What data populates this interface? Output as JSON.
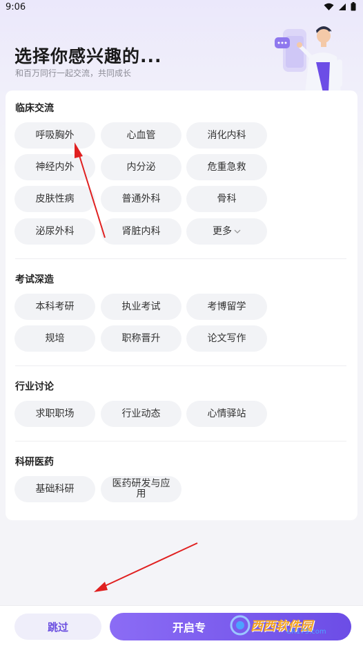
{
  "status_bar": {
    "time": "9:06"
  },
  "header": {
    "title": "选择你感兴趣的...",
    "subtitle": "和百万同行一起交流，共同成长"
  },
  "sections": [
    {
      "title": "临床交流",
      "tags": [
        "呼吸胸外",
        "心血管",
        "消化内科",
        "神经内外",
        "内分泌",
        "危重急救",
        "皮肤性病",
        "普通外科",
        "骨科",
        "泌尿外科",
        "肾脏内科"
      ],
      "more_label": "更多"
    },
    {
      "title": "考试深造",
      "tags": [
        "本科考研",
        "执业考试",
        "考博留学",
        "规培",
        "职称晋升",
        "论文写作"
      ]
    },
    {
      "title": "行业讨论",
      "tags": [
        "求职职场",
        "行业动态",
        "心情驿站"
      ]
    },
    {
      "title": "科研医药",
      "tags": [
        "基础科研",
        "医药研发与应用"
      ]
    }
  ],
  "footer": {
    "skip_label": "跳过",
    "start_label": "开启专"
  },
  "watermark": {
    "text": "西西软件园",
    "sub": "CR173.com"
  },
  "colors": {
    "accent": "#6c4de6",
    "tag_bg": "#f2f3f6",
    "arrow": "#e02020"
  }
}
